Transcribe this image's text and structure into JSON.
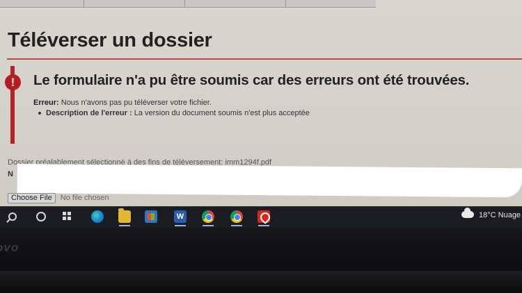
{
  "page": {
    "title": "Téléverser un dossier"
  },
  "error_box": {
    "icon": "!",
    "heading": "Le formulaire n'a pu être soumis car des erreurs ont été trouvées.",
    "error_label": "Erreur:",
    "error_text": "Nous n'avons pas pu téléverser votre fichier.",
    "description_label": "Description de l'erreur :",
    "description_text": "La version du document soumis n'est plus acceptée",
    "accent_color": "#b72326"
  },
  "upload": {
    "previous_file_text": "Dossier préalablement sélectionné à des fins de téléversement: imm1294f.pdf",
    "name_label": "N",
    "choose_button": "Choose File",
    "no_file_text": "No file chosen"
  },
  "taskbar": {
    "icons": [
      "search-icon",
      "cortana-icon",
      "task-view-icon",
      "edge-icon",
      "file-explorer-icon",
      "store-icon",
      "word-icon",
      "chrome-icon",
      "chrome-icon",
      "acrobat-icon"
    ],
    "word_letter": "W",
    "weather_text": "18°C  Nuage"
  },
  "bezel": {
    "brand": "ovo"
  }
}
